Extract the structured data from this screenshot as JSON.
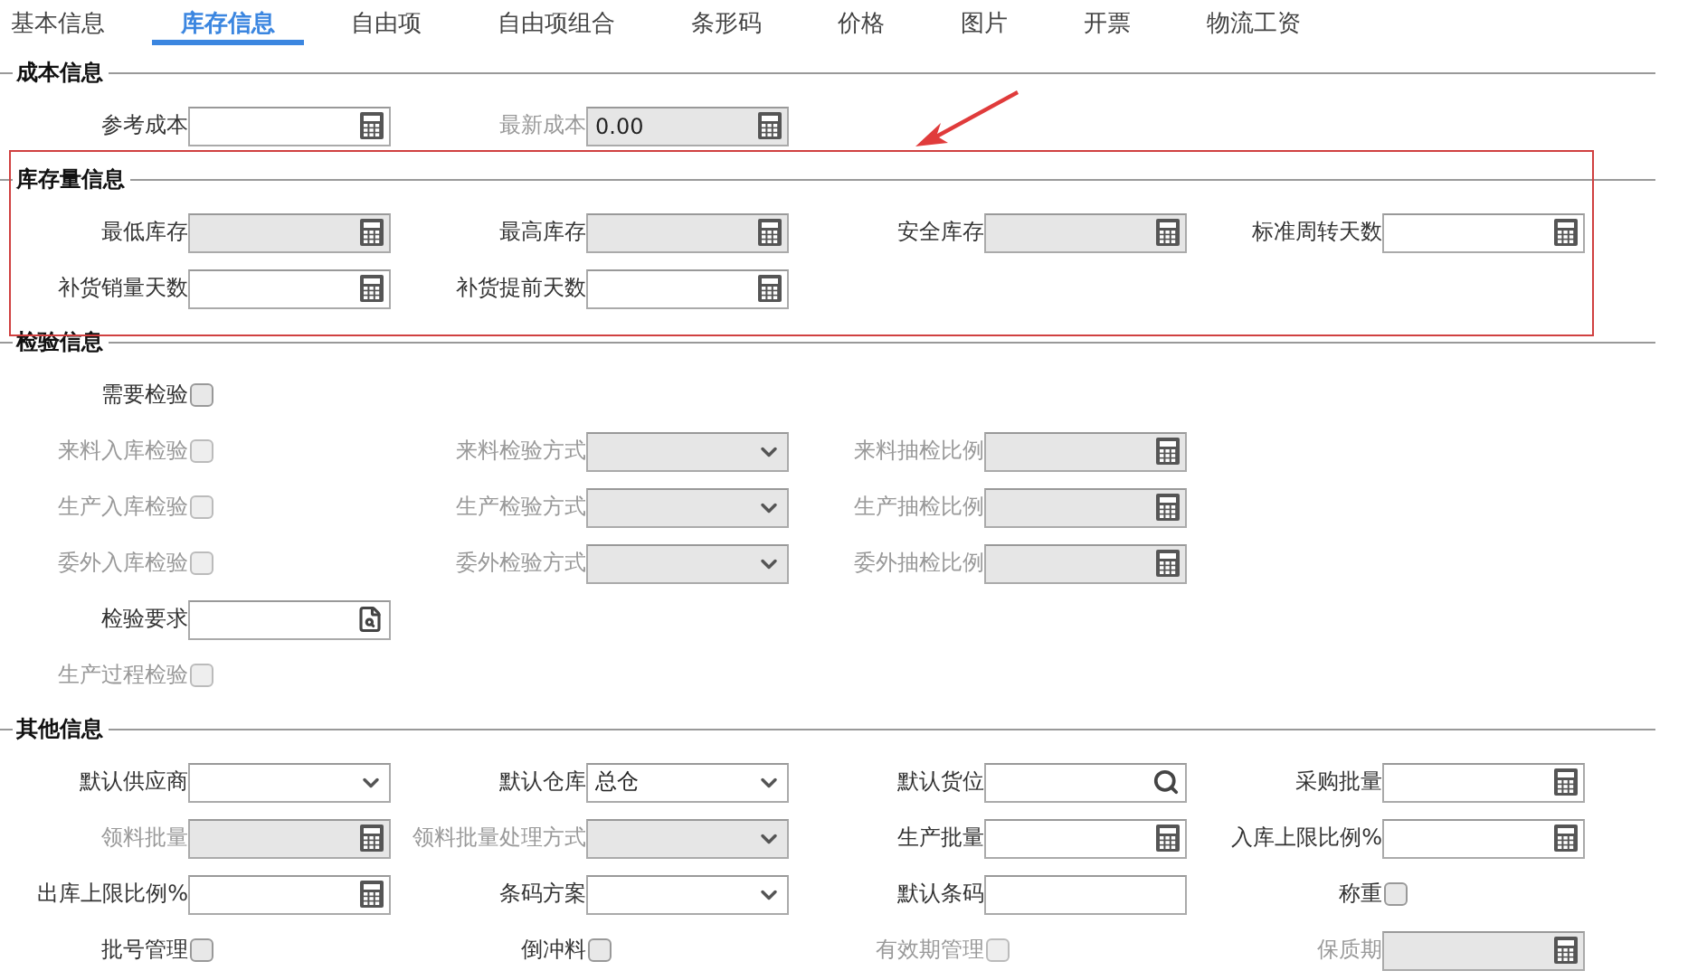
{
  "tabs": [
    {
      "label": "基本信息",
      "selected": false
    },
    {
      "label": "库存信息",
      "selected": true
    },
    {
      "label": "自由项",
      "selected": false
    },
    {
      "label": "自由项组合",
      "selected": false
    },
    {
      "label": "条形码",
      "selected": false
    },
    {
      "label": "价格",
      "selected": false
    },
    {
      "label": "图片",
      "selected": false
    },
    {
      "label": "开票",
      "selected": false
    },
    {
      "label": "物流工资",
      "selected": false
    }
  ],
  "sections": [
    {
      "title": "成本信息",
      "rows": [
        [
          {
            "kind": "calc",
            "label": "参考成本",
            "disabled": false,
            "readonly": false
          },
          {
            "kind": "calc",
            "label": "最新成本",
            "value": "0.00",
            "disabled": true,
            "readonly": true
          }
        ]
      ]
    },
    {
      "title": "库存量信息",
      "rows": [
        [
          {
            "kind": "calc",
            "label": "最低库存",
            "disabled": false,
            "readonly": true
          },
          {
            "kind": "calc",
            "label": "最高库存",
            "disabled": false,
            "readonly": true
          },
          {
            "kind": "calc",
            "label": "安全库存",
            "disabled": false,
            "readonly": true
          },
          {
            "kind": "calc",
            "label": "标准周转天数",
            "disabled": false,
            "readonly": false
          }
        ],
        [
          {
            "kind": "calc",
            "label": "补货销量天数",
            "disabled": false,
            "readonly": false
          },
          {
            "kind": "calc",
            "label": "补货提前天数",
            "disabled": false,
            "readonly": false
          }
        ]
      ]
    },
    {
      "title": "检验信息",
      "rows": [
        [
          {
            "kind": "checkbox",
            "label": "需要检验",
            "checked": false,
            "disabled": false
          }
        ],
        [
          {
            "kind": "checkbox",
            "label": "来料入库检验",
            "checked": false,
            "disabled": true
          },
          {
            "kind": "select",
            "label": "来料检验方式",
            "disabled": true,
            "readonly": true
          },
          {
            "kind": "calc",
            "label": "来料抽检比例",
            "disabled": true,
            "readonly": true
          }
        ],
        [
          {
            "kind": "checkbox",
            "label": "生产入库检验",
            "checked": false,
            "disabled": true
          },
          {
            "kind": "select",
            "label": "生产检验方式",
            "disabled": true,
            "readonly": true
          },
          {
            "kind": "calc",
            "label": "生产抽检比例",
            "disabled": true,
            "readonly": true
          }
        ],
        [
          {
            "kind": "checkbox",
            "label": "委外入库检验",
            "checked": false,
            "disabled": true
          },
          {
            "kind": "select",
            "label": "委外检验方式",
            "disabled": true,
            "readonly": true
          },
          {
            "kind": "calc",
            "label": "委外抽检比例",
            "disabled": true,
            "readonly": true
          }
        ],
        [
          {
            "kind": "lookup",
            "label": "检验要求",
            "disabled": false,
            "readonly": false
          }
        ],
        [
          {
            "kind": "checkbox",
            "label": "生产过程检验",
            "checked": false,
            "disabled": true
          }
        ]
      ]
    },
    {
      "title": "其他信息",
      "rows": [
        [
          {
            "kind": "select",
            "label": "默认供应商",
            "disabled": false,
            "readonly": false
          },
          {
            "kind": "select",
            "label": "默认仓库",
            "value": "总仓",
            "disabled": false,
            "readonly": false
          },
          {
            "kind": "search",
            "label": "默认货位",
            "disabled": false,
            "readonly": false
          },
          {
            "kind": "calc",
            "label": "采购批量",
            "disabled": false,
            "readonly": false
          }
        ],
        [
          {
            "kind": "calc",
            "label": "领料批量",
            "disabled": true,
            "readonly": true
          },
          {
            "kind": "select",
            "label": "领料批量处理方式",
            "disabled": true,
            "readonly": true
          },
          {
            "kind": "calc",
            "label": "生产批量",
            "disabled": false,
            "readonly": false
          },
          {
            "kind": "calc",
            "label": "入库上限比例%",
            "disabled": false,
            "readonly": false
          }
        ],
        [
          {
            "kind": "calc",
            "label": "出库上限比例%",
            "disabled": false,
            "readonly": false
          },
          {
            "kind": "select",
            "label": "条码方案",
            "disabled": false,
            "readonly": false
          },
          {
            "kind": "text",
            "label": "默认条码",
            "disabled": false,
            "readonly": false
          },
          {
            "kind": "checkbox",
            "label": "称重",
            "checked": false,
            "disabled": false
          }
        ],
        [
          {
            "kind": "checkbox",
            "label": "批号管理",
            "checked": false,
            "disabled": false
          },
          {
            "kind": "checkbox",
            "label": "倒冲料",
            "checked": false,
            "disabled": false
          },
          {
            "kind": "checkbox",
            "label": "有效期管理",
            "checked": false,
            "disabled": true
          },
          {
            "kind": "calc",
            "label": "保质期",
            "disabled": true,
            "readonly": true
          }
        ]
      ]
    }
  ]
}
